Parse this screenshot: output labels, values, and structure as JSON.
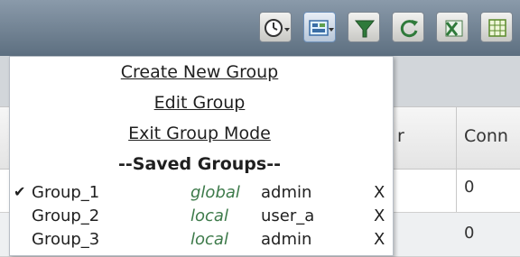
{
  "toolbar": {
    "buttons": [
      {
        "icon": "clock-dropdown-icon"
      },
      {
        "icon": "group-dropdown-icon"
      },
      {
        "icon": "filter-icon"
      },
      {
        "icon": "refresh-icon"
      },
      {
        "icon": "export-excel-icon"
      },
      {
        "icon": "table-icon"
      }
    ]
  },
  "grid": {
    "headers": {
      "partial_left": "r",
      "connections": "Conn"
    },
    "rows": [
      {
        "value": "0"
      },
      {
        "value": "0"
      }
    ]
  },
  "menu": {
    "create": "Create New Group",
    "edit": "Edit Group",
    "exit": "Exit Group Mode",
    "saved_heading": "--Saved Groups--",
    "groups": [
      {
        "checked": true,
        "check_mark": "✔",
        "name": "Group_1",
        "scope": "global",
        "owner": "admin",
        "delete": "X"
      },
      {
        "checked": false,
        "check_mark": "",
        "name": "Group_2",
        "scope": "local",
        "owner": "user_a",
        "delete": "X"
      },
      {
        "checked": false,
        "check_mark": "",
        "name": "Group_3",
        "scope": "local",
        "owner": "admin",
        "delete": "X"
      }
    ]
  },
  "colors": {
    "toolbar_top": "#8a9aaa",
    "toolbar_bottom": "#5d6f80",
    "scope_text": "#3d7a4a",
    "active_button": "#b7c6d8"
  }
}
